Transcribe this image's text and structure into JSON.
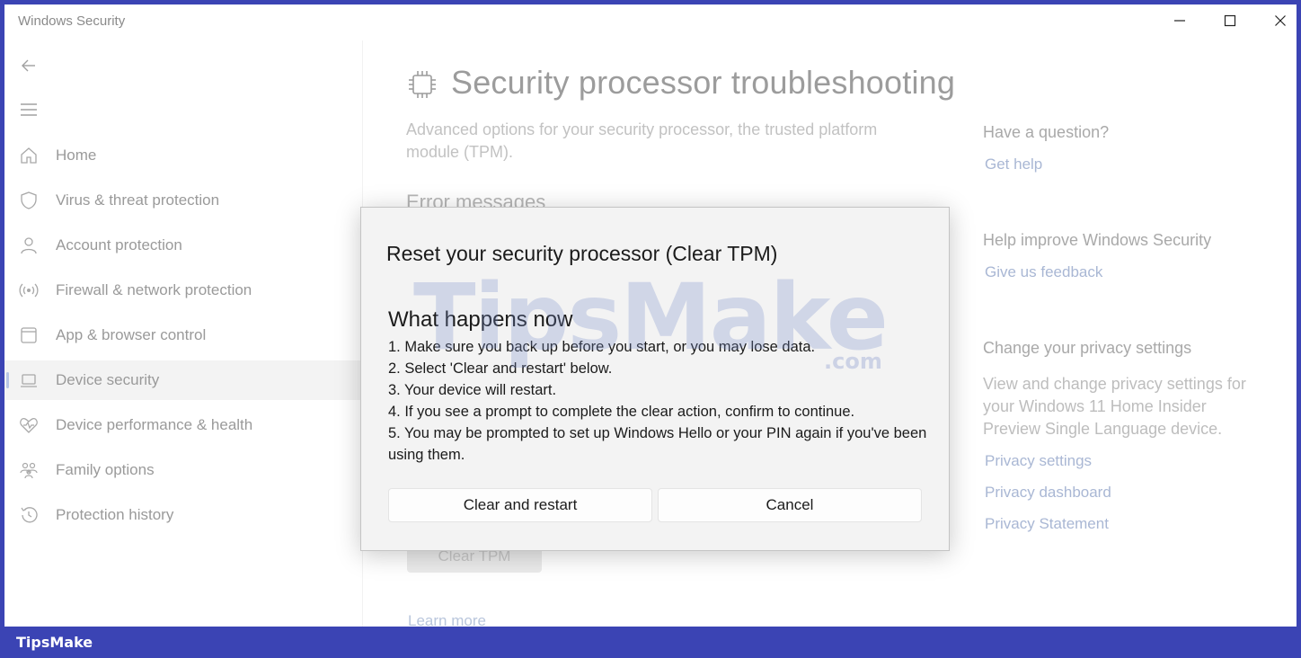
{
  "window": {
    "title": "Windows Security",
    "controls": {
      "minimize": "minimize-icon",
      "maximize": "maximize-icon",
      "close": "close-icon"
    }
  },
  "nav": {
    "back_icon": "back-arrow-icon",
    "menu_icon": "hamburger-menu-icon",
    "items": [
      {
        "label": "Home",
        "icon": "home-icon"
      },
      {
        "label": "Virus & threat protection",
        "icon": "shield-icon"
      },
      {
        "label": "Account protection",
        "icon": "person-icon"
      },
      {
        "label": "Firewall & network protection",
        "icon": "antenna-icon"
      },
      {
        "label": "App & browser control",
        "icon": "browser-window-icon"
      },
      {
        "label": "Device security",
        "icon": "laptop-icon",
        "active": true
      },
      {
        "label": "Device performance & health",
        "icon": "heart-pulse-icon"
      },
      {
        "label": "Family options",
        "icon": "family-icon"
      },
      {
        "label": "Protection history",
        "icon": "history-icon"
      }
    ]
  },
  "main": {
    "title": "Security processor troubleshooting",
    "title_icon": "chip-icon",
    "description": "Advanced options for your security processor, the trusted platform module (TPM).",
    "section_heading": "Error messages",
    "clear_tpm_button": "Clear TPM",
    "learn_more": "Learn more"
  },
  "sidebar_right": {
    "question_heading": "Have a question?",
    "get_help": "Get help",
    "improve_heading": "Help improve Windows Security",
    "feedback": "Give us feedback",
    "privacy_heading": "Change your privacy settings",
    "privacy_text": "View and change privacy settings for your Windows 11 Home Insider Preview Single Language device.",
    "privacy_settings": "Privacy settings",
    "privacy_dashboard": "Privacy dashboard",
    "privacy_statement": "Privacy Statement"
  },
  "dialog": {
    "title": "Reset your security processor (Clear TPM)",
    "subtitle": "What happens now",
    "steps": [
      "1. Make sure you back up before you start, or you may lose data.",
      "2. Select 'Clear and restart' below.",
      "3. Your device will restart.",
      "4. If you see a prompt to complete the clear action, confirm to continue.",
      "5. You may be prompted to set up Windows Hello or your PIN again if you've been using them."
    ],
    "primary_button": "Clear and restart",
    "secondary_button": "Cancel"
  },
  "watermark": {
    "big": "TipsMake",
    "small": ".com",
    "footer": "TipsMake"
  }
}
